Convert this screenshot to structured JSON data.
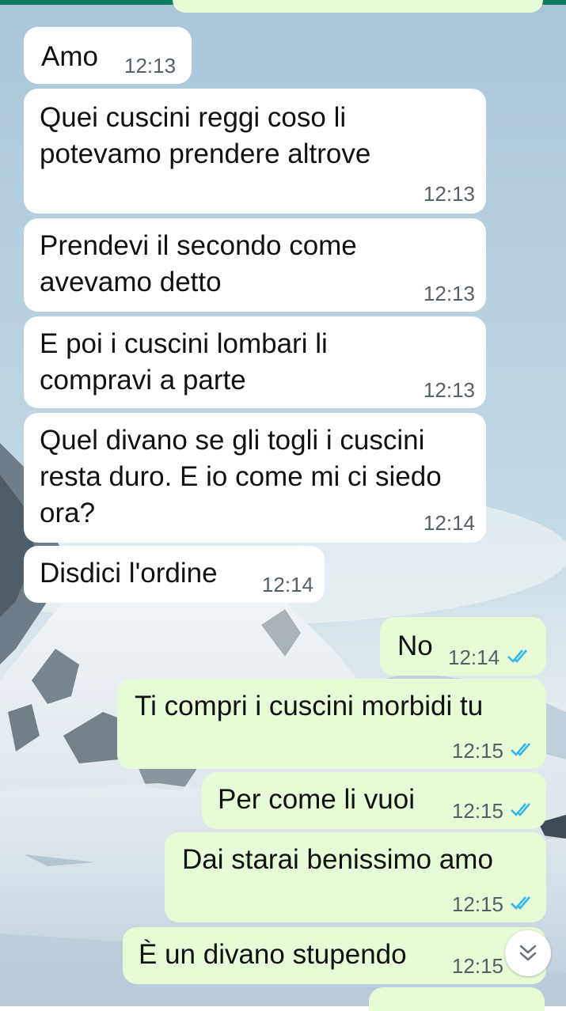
{
  "theme": {
    "header_color": "#0f7c5e",
    "incoming_bubble": "#ffffff",
    "outgoing_bubble": "#e7fbd7",
    "read_tick_color": "#34b7f1"
  },
  "messages": [
    {
      "direction": "incoming",
      "text": "Amo",
      "time": "12:13"
    },
    {
      "direction": "incoming",
      "text": "Quei cuscini reggi coso li potevamo prendere altrove",
      "time": "12:13"
    },
    {
      "direction": "incoming",
      "text": "Prendevi il secondo come avevamo detto",
      "time": "12:13"
    },
    {
      "direction": "incoming",
      "text": "E poi i cuscini lombari li compravi a parte",
      "time": "12:13"
    },
    {
      "direction": "incoming",
      "text": "Quel divano se gli togli i cuscini resta duro. E io come mi ci siedo ora?",
      "time": "12:14"
    },
    {
      "direction": "incoming",
      "text": "Disdici l'ordine",
      "time": "12:14"
    },
    {
      "direction": "outgoing",
      "text": "No",
      "time": "12:14",
      "status": "read"
    },
    {
      "direction": "outgoing",
      "text": "Ti compri i cuscini morbidi tu",
      "time": "12:15",
      "status": "read"
    },
    {
      "direction": "outgoing",
      "text": "Per come li vuoi",
      "time": "12:15",
      "status": "read"
    },
    {
      "direction": "outgoing",
      "text": "Dai starai benissimo amo",
      "time": "12:15",
      "status": "read"
    },
    {
      "direction": "outgoing",
      "text": "È un divano stupendo",
      "time": "12:15",
      "status": "read"
    }
  ],
  "scroll_button": {
    "icon": "double-chevron-down-icon"
  }
}
